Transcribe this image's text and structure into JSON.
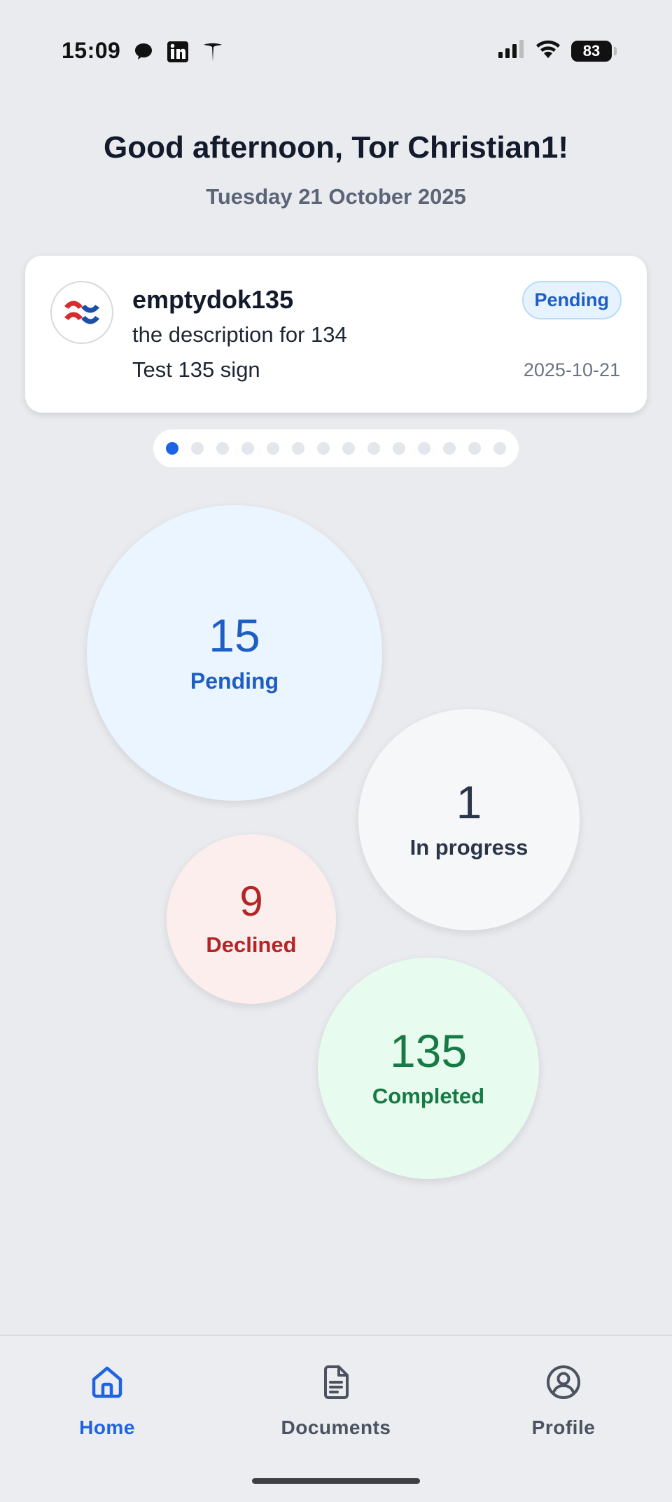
{
  "status_bar": {
    "time": "15:09",
    "battery": "83",
    "left_icons": [
      "messenger-icon",
      "linkedin-icon",
      "tesla-icon"
    ],
    "right_icons": [
      "signal-icon",
      "wifi-icon",
      "battery-icon"
    ]
  },
  "header": {
    "greeting": "Good afternoon, Tor Christian1!",
    "date": "Tuesday 21 October 2025"
  },
  "document_card": {
    "title": "emptydok135",
    "description": "the description for 134",
    "subtitle": "Test 135 sign",
    "status": "Pending",
    "date": "2025-10-21"
  },
  "pager": {
    "total": 14,
    "active_index": 0
  },
  "stats": {
    "pending": {
      "count": "15",
      "label": "Pending"
    },
    "in_progress": {
      "count": "1",
      "label": "In progress"
    },
    "declined": {
      "count": "9",
      "label": "Declined"
    },
    "completed": {
      "count": "135",
      "label": "Completed"
    }
  },
  "colors": {
    "accent": "#1e63e6",
    "pending": "#1e5ec4",
    "declined": "#b42525",
    "completed": "#177a45"
  },
  "bottom_nav": {
    "items": [
      {
        "label": "Home",
        "icon": "home-icon",
        "active": true
      },
      {
        "label": "Documents",
        "icon": "document-icon",
        "active": false
      },
      {
        "label": "Profile",
        "icon": "profile-icon",
        "active": false
      }
    ]
  }
}
